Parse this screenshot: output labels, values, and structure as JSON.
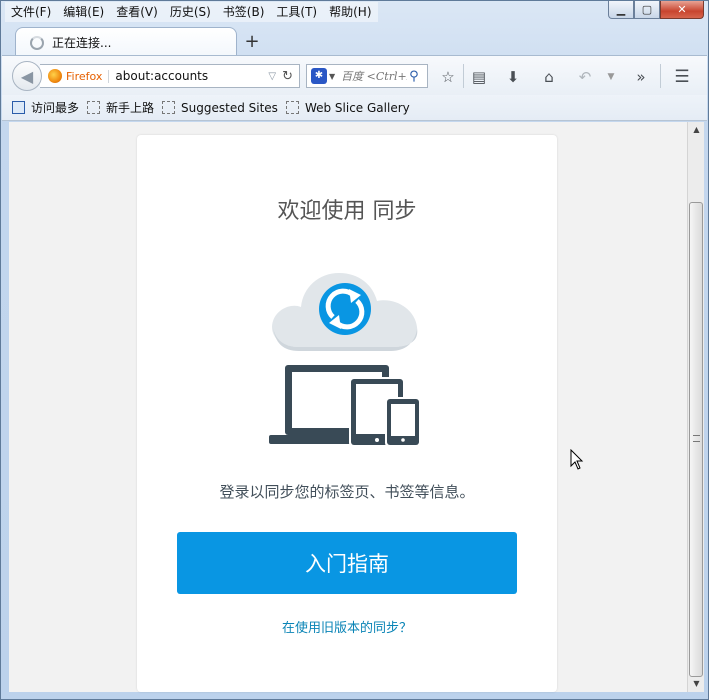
{
  "menu": [
    "文件(F)",
    "编辑(E)",
    "查看(V)",
    "历史(S)",
    "书签(B)",
    "工具(T)",
    "帮助(H)"
  ],
  "window_controls": {
    "minimize": "▁",
    "maximize": "▢",
    "close": "✕"
  },
  "tab": {
    "title": "正在连接...",
    "new_tab": "+"
  },
  "urlbar": {
    "identity": "Firefox",
    "url": "about:accounts"
  },
  "search": {
    "placeholder": "百度 <Ctrl+K>"
  },
  "bookmarks": [
    "访问最多",
    "新手上路",
    "Suggested Sites",
    "Web Slice Gallery"
  ],
  "page": {
    "title": "欢迎使用 同步",
    "description": "登录以同步您的标签页、书签等信息。",
    "cta_label": "入门指南",
    "legacy_link": "在使用旧版本的同步？"
  },
  "colors": {
    "accent": "#0996e3",
    "link": "#0a84b6",
    "cloud": "#e1e6ea",
    "device": "#394a56"
  }
}
